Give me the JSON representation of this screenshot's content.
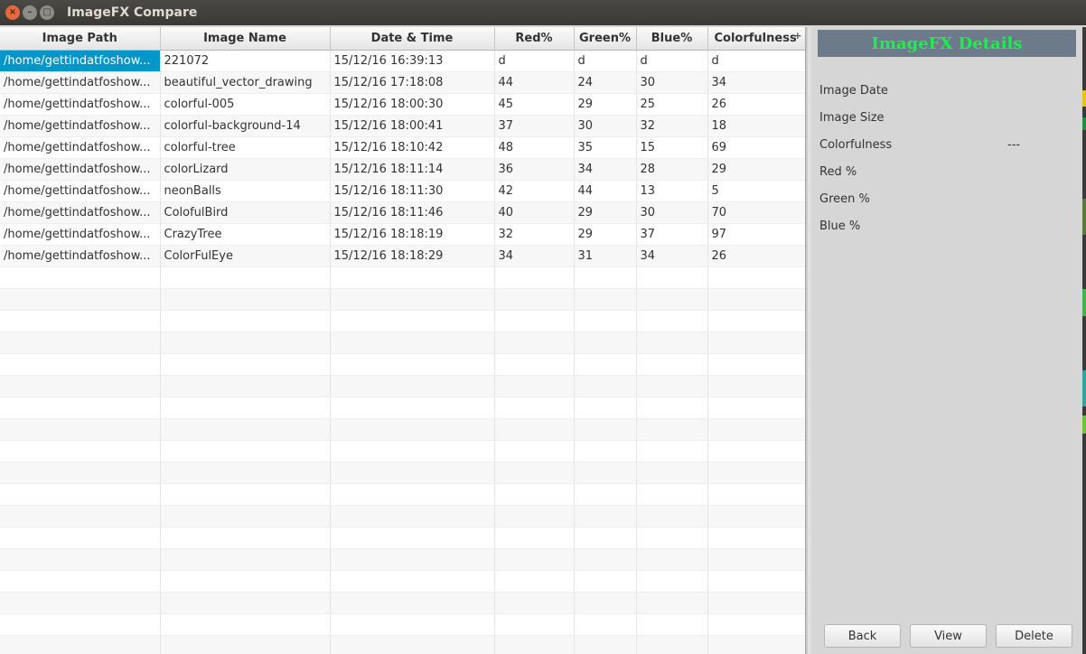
{
  "window": {
    "title": "ImageFX Compare",
    "close_icon": "×",
    "minimize_icon": "–",
    "maximize_icon": "□"
  },
  "table": {
    "columns": [
      "Image Path",
      "Image Name",
      "Date & Time",
      "Red%",
      "Green%",
      "Blue%",
      "Colorfulness"
    ],
    "corner_icon": "+",
    "rows": [
      [
        "/home/gettindatfoshow...",
        "221072",
        "15/12/16 16:39:13",
        "d",
        "d",
        "d",
        "d"
      ],
      [
        "/home/gettindatfoshow...",
        "beautiful_vector_drawing",
        "15/12/16 17:18:08",
        "44",
        "24",
        "30",
        "34"
      ],
      [
        "/home/gettindatfoshow...",
        "colorful-005",
        "15/12/16 18:00:30",
        "45",
        "29",
        "25",
        "26"
      ],
      [
        "/home/gettindatfoshow...",
        "colorful-background-14",
        "15/12/16 18:00:41",
        "37",
        "30",
        "32",
        "18"
      ],
      [
        "/home/gettindatfoshow...",
        "colorful-tree",
        "15/12/16 18:10:42",
        "48",
        "35",
        "15",
        "69"
      ],
      [
        "/home/gettindatfoshow...",
        "colorLizard",
        "15/12/16 18:11:14",
        "36",
        "34",
        "28",
        "29"
      ],
      [
        "/home/gettindatfoshow...",
        "neonBalls",
        "15/12/16 18:11:30",
        "42",
        "44",
        "13",
        "5"
      ],
      [
        "/home/gettindatfoshow...",
        "ColofulBird",
        "15/12/16 18:11:46",
        "40",
        "29",
        "30",
        "70"
      ],
      [
        "/home/gettindatfoshow...",
        "CrazyTree",
        "15/12/16 18:18:19",
        "32",
        "29",
        "37",
        "97"
      ],
      [
        "/home/gettindatfoshow...",
        "ColorFulEye",
        "15/12/16 18:18:29",
        "34",
        "31",
        "34",
        "26"
      ]
    ]
  },
  "details": {
    "heading": "ImageFX Details",
    "image_date_label": "Image Date",
    "image_size_label": "Image Size",
    "colorfulness_label": "Colorfulness",
    "colorfulness_value": "---",
    "red_label": "Red %",
    "green_label": "Green %",
    "blue_label": "Blue %",
    "back_label": "Back",
    "view_label": "View",
    "delete_label": "Delete"
  },
  "colors": {
    "selection": "#0096c9",
    "heading_bg": "#6c7a89",
    "heading_text": "#1bf04a"
  }
}
